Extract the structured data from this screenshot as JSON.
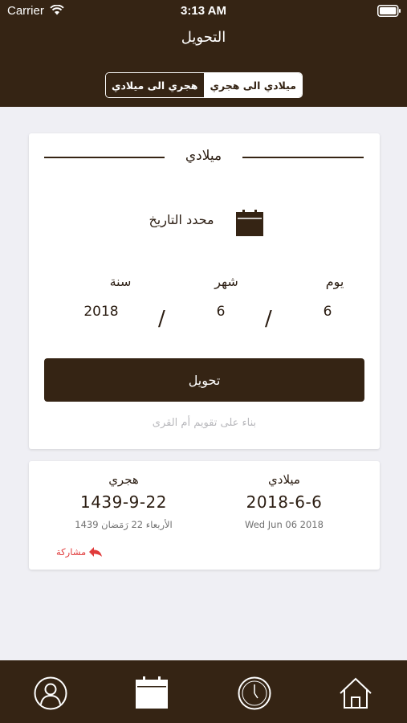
{
  "status_bar": {
    "carrier": "Carrier",
    "time": "3:13 AM"
  },
  "nav": {
    "title": "التحويل"
  },
  "segmented": {
    "left_label": "هجري الى ميلادي",
    "right_label": "ميلادي الى هجري",
    "selected": "right"
  },
  "converter": {
    "section_title": "ميلادي",
    "date_picker_label": "محدد التاريخ",
    "fields": {
      "day_label": "يوم",
      "day_value": "6",
      "month_label": "شهر",
      "month_value": "6",
      "year_label": "سنة",
      "year_value": "2018",
      "separator": "/"
    },
    "convert_button": "تحويل",
    "note": "بناء على تقويم أم القرى"
  },
  "result": {
    "gregorian_label": "ميلادي",
    "gregorian_date": "2018-6-6",
    "gregorian_sub": "Wed Jun 06 2018",
    "hijri_label": "هجري",
    "hijri_date": "1439-9-22",
    "hijri_sub": "الأربعاء 22 رَمَضان 1439",
    "share_label": "مشاركة"
  },
  "tabbar": {
    "items": [
      "profile-icon",
      "calendar-icon",
      "clock-icon",
      "home-icon"
    ],
    "selected": "calendar-icon"
  },
  "colors": {
    "brand": "#352414",
    "background": "#efeff4",
    "share": "#e03b3b",
    "note": "#b9b9bd"
  }
}
